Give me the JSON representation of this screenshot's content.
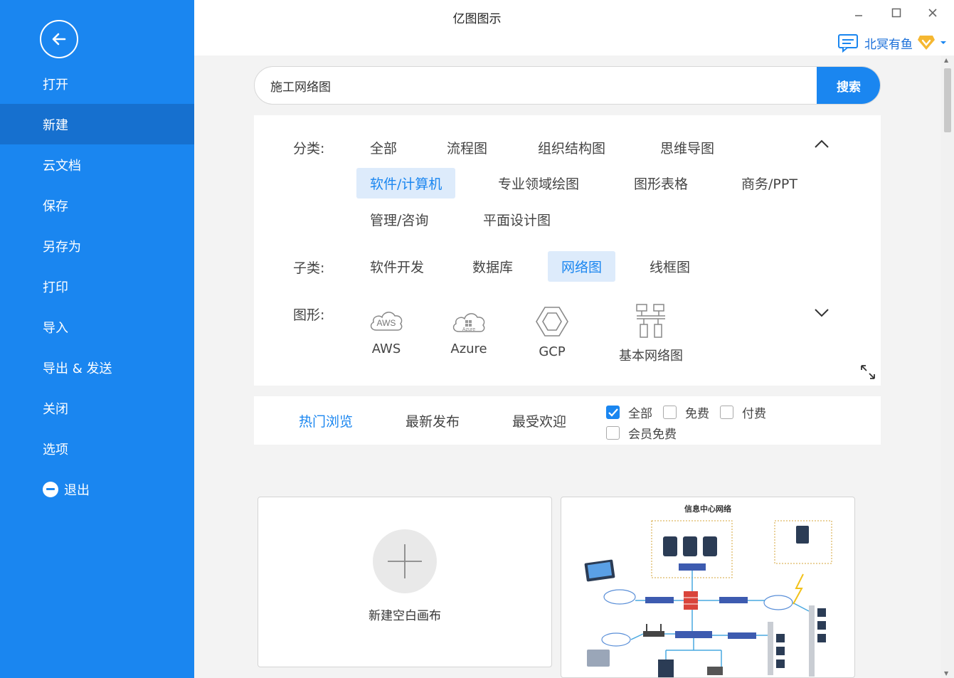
{
  "app": {
    "title": "亿图图示"
  },
  "window": {
    "minimize": "–",
    "maximize": "□",
    "close": "✕"
  },
  "user": {
    "name": "北冥有鱼"
  },
  "sidebar": {
    "items": [
      {
        "label": "打开"
      },
      {
        "label": "新建",
        "active": true
      },
      {
        "label": "云文档"
      },
      {
        "label": "保存"
      },
      {
        "label": "另存为"
      },
      {
        "label": "打印"
      },
      {
        "label": "导入"
      },
      {
        "label": "导出 & 发送"
      },
      {
        "label": "关闭"
      },
      {
        "label": "选项"
      },
      {
        "label": "退出"
      }
    ]
  },
  "search": {
    "value": "施工网络图",
    "button": "搜索"
  },
  "filters": {
    "category_label": "分类:",
    "categories": [
      "全部",
      "流程图",
      "组织结构图",
      "思维导图",
      "软件/计算机",
      "专业领域绘图",
      "图形表格",
      "商务/PPT",
      "管理/咨询",
      "平面设计图"
    ],
    "category_selected": "软件/计算机",
    "subcategory_label": "子类:",
    "subcategories": [
      "软件开发",
      "数据库",
      "网络图",
      "线框图"
    ],
    "subcategory_selected": "网络图",
    "shape_label": "图形:",
    "shapes": [
      {
        "label": "AWS",
        "icon": "aws-cloud-icon",
        "icon_text": "AWS"
      },
      {
        "label": "Azure",
        "icon": "azure-cloud-icon",
        "icon_text": "Azure"
      },
      {
        "label": "GCP",
        "icon": "gcp-hexagon-icon"
      },
      {
        "label": "基本网络图",
        "icon": "network-topology-icon"
      }
    ]
  },
  "sort": {
    "tabs": [
      "热门浏览",
      "最新发布",
      "最受欢迎"
    ],
    "active_tab": "热门浏览",
    "checkboxes": [
      {
        "label": "全部",
        "checked": true
      },
      {
        "label": "免费",
        "checked": false
      },
      {
        "label": "付费",
        "checked": false
      },
      {
        "label": "会员免费",
        "checked": false
      }
    ]
  },
  "cards": {
    "blank_label": "新建空白画布",
    "template_title": "信息中心网络"
  },
  "colors": {
    "accent": "#1a86f0",
    "sidebar": "#1a86f0",
    "sidebar_active": "#1670cf",
    "chip_active_bg": "#ddebfb",
    "vip_badge": "#f5b731"
  }
}
